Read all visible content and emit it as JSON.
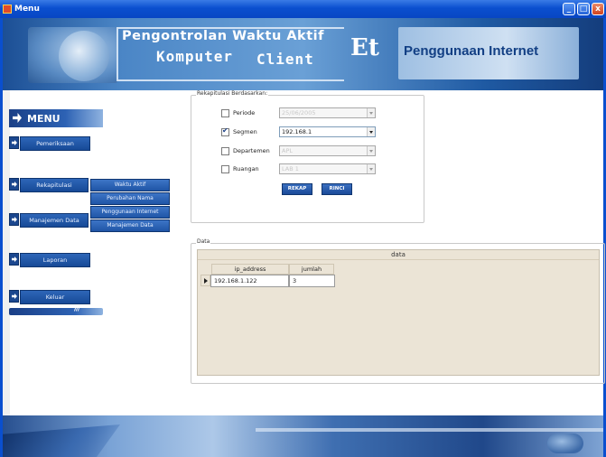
{
  "window": {
    "title": "Menu",
    "buttons": {
      "minimize": "_",
      "maximize": "□",
      "close": "x"
    }
  },
  "banner": {
    "line1": "Pengontrolan Waktu Aktif",
    "line2a": "Komputer",
    "line2b": "Client",
    "logo": "Et",
    "line3": "Penggunaan Internet"
  },
  "menu": {
    "header": "MENU",
    "items": [
      {
        "label": "Pemeriksaan"
      },
      {
        "label": "Rekapitulasi"
      },
      {
        "label": "Manajemen Data"
      },
      {
        "label": "Laporan"
      },
      {
        "label": "Keluar"
      }
    ],
    "submenu": [
      {
        "label": "Waktu Aktif"
      },
      {
        "label": "Perubahan Nama"
      },
      {
        "label": "Penggunaan Internet"
      },
      {
        "label": "Manajemen Data"
      }
    ]
  },
  "rekap": {
    "group_title": "Rekapitulasi Berdasarkan:",
    "rows": [
      {
        "label": "Periode",
        "checked": false,
        "value": "25/06/2005"
      },
      {
        "label": "Segmen",
        "checked": true,
        "value": "192.168.1"
      },
      {
        "label": "Departemen",
        "checked": false,
        "value": "APL"
      },
      {
        "label": "Ruangan",
        "checked": false,
        "value": "LAB 1"
      }
    ],
    "buttons": {
      "rekap": "REKAP",
      "rinci": "RINCI"
    }
  },
  "data_panel": {
    "group_title": "Data",
    "caption": "data",
    "columns": [
      "ip_address",
      "jumlah"
    ],
    "rows": [
      [
        "192.168.1.122",
        "3"
      ]
    ]
  }
}
